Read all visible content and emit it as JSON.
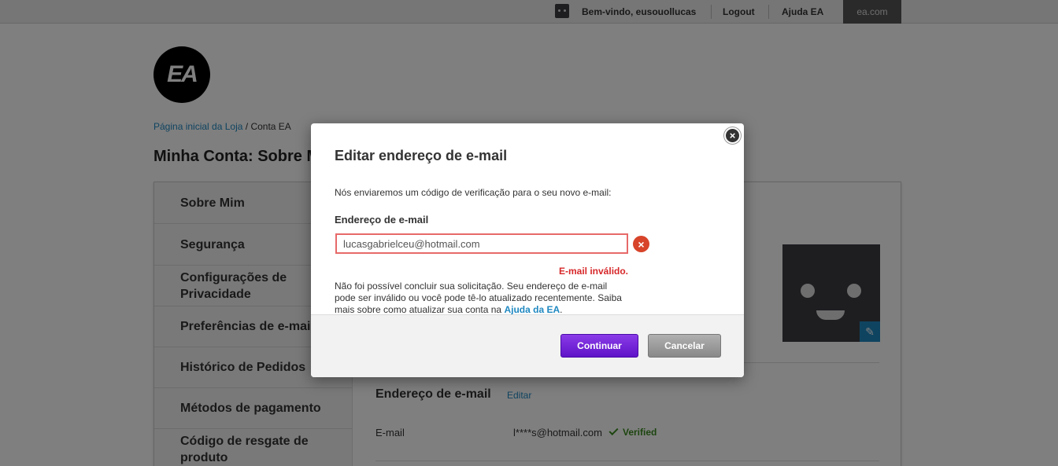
{
  "topbar": {
    "welcome": "Bem-vindo, eusouollucas",
    "logout": "Logout",
    "help": "Ajuda EA",
    "eacom": "ea.com"
  },
  "logo": {
    "text": "EA"
  },
  "breadcrumb": {
    "home": "Página inicial da Loja",
    "separator": " / ",
    "current": "Conta EA"
  },
  "page": {
    "title": "Minha Conta: Sobre Mim"
  },
  "sidebar": {
    "items": [
      {
        "label": "Sobre Mim"
      },
      {
        "label": "Segurança"
      },
      {
        "label": "Configurações de Privacidade"
      },
      {
        "label": "Preferências de e-mail"
      },
      {
        "label": "Histórico de Pedidos"
      },
      {
        "label": "Métodos de pagamento"
      },
      {
        "label": "Código de resgate de produto"
      }
    ]
  },
  "profile": {
    "pencil_glyph": "✎"
  },
  "email_section": {
    "title": "Endereço de e-mail",
    "edit": "Editar",
    "row_label": "E-mail",
    "row_value": "l****s@hotmail.com",
    "verified": "Verified"
  },
  "modal": {
    "close_glyph": "×",
    "title": "Editar endereço de e-mail",
    "description": "Nós enviaremos um código de verificação para o seu novo e-mail:",
    "field_label": "Endereço de e-mail",
    "field_value": "lucasgabrielceu@hotmail.com",
    "error_glyph": "×",
    "error_short": "E-mail inválido.",
    "error_para": "Não foi possível concluir sua solicitação. Seu endereço de e-mail pode ser inválido ou você pode tê-lo atualizado recentemente. Saiba mais sobre como atualizar sua conta na ",
    "help_link": "Ajuda da EA",
    "para_end": ".",
    "continue": "Continuar",
    "cancel": "Cancelar"
  },
  "colors": {
    "accent_blue": "#1f88c1",
    "primary_purple": "#6a1bd6",
    "error_red": "#d7282a",
    "verified_green": "#3a8a1f"
  }
}
